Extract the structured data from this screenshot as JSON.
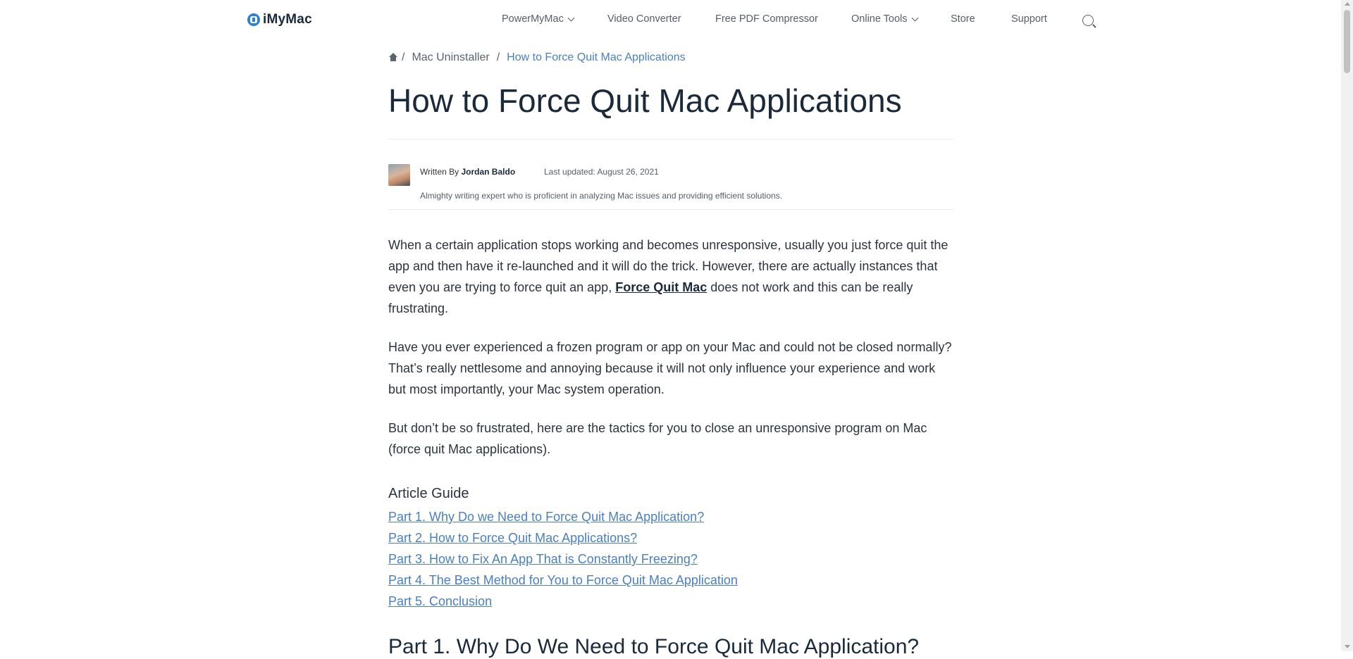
{
  "header": {
    "logo_text": "iMyMac",
    "nav": [
      {
        "label": "PowerMyMac",
        "has_dropdown": true
      },
      {
        "label": "Video Converter",
        "has_dropdown": false
      },
      {
        "label": "Free PDF Compressor",
        "has_dropdown": false
      },
      {
        "label": "Online Tools",
        "has_dropdown": true
      },
      {
        "label": "Store",
        "has_dropdown": false
      },
      {
        "label": "Support",
        "has_dropdown": false
      }
    ],
    "search_icon": "search-icon"
  },
  "breadcrumb": {
    "home_icon": "home-icon",
    "separator": "/",
    "items": [
      "Mac Uninstaller",
      "How to Force Quit Mac Applications"
    ]
  },
  "article": {
    "title": "How to Force Quit Mac Applications",
    "author": {
      "written_by": "Written By",
      "name": "Jordan Baldo",
      "updated": "Last updated: August 26, 2021",
      "bio": "Almighty writing expert who is proficient in analyzing Mac issues and providing efficient solutions."
    },
    "paragraphs": [
      {
        "before": "When a certain application stops working and becomes unresponsive, usually you just force quit the app and then have it re-launched and it will do the trick. However, there are actually instances that even you are trying to force quit an app, ",
        "link": "Force Quit Mac",
        "after": " does not work and this can be really frustrating."
      },
      {
        "text": "Have you ever experienced a frozen program or app on your Mac and could not be closed normally? That’s really nettlesome and annoying because it will not only influence your experience and work but most importantly, your Mac system operation."
      },
      {
        "text": "But don’t be so frustrated, here are the tactics for you to close an unresponsive program on Mac (force quit Mac applications)."
      }
    ],
    "guide_title": "Article Guide",
    "guide_links": [
      "Part 1. Why Do we Need to Force Quit Mac Application?",
      "Part 2. How to Force Quit Mac Applications?",
      "Part 3. How to Fix An App That is Constantly Freezing?",
      "Part 4. The Best Method for You to Force Quit Mac Application",
      "Part 5. Conclusion"
    ],
    "section_heading": "Part 1. Why Do We Need to Force Quit Mac Application?"
  },
  "colors": {
    "accent_link": "#4a7fc1",
    "text": "#2c3440",
    "heading": "#1a2a3a",
    "logo": "#2f7ed8"
  }
}
